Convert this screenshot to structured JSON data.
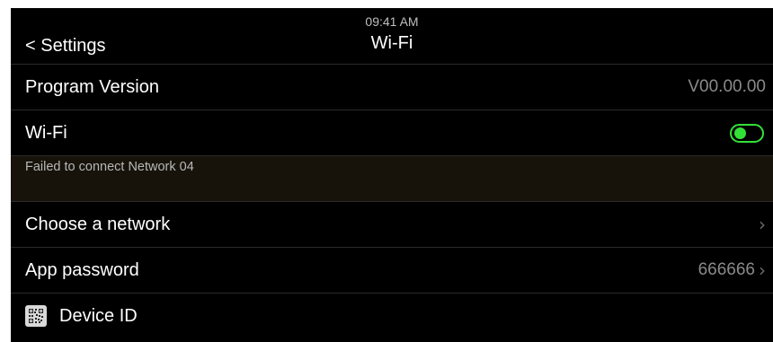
{
  "status_bar": {
    "time": "09:41 AM"
  },
  "nav": {
    "back_label": "< Settings",
    "title": "Wi-Fi"
  },
  "rows": {
    "program_version": {
      "label": "Program Version",
      "value": "V00.00.00"
    },
    "wifi": {
      "label": "Wi-Fi",
      "toggle_on": true
    },
    "status_message": "Failed to connect Network 04",
    "choose_network": {
      "label": "Choose a network"
    },
    "app_password": {
      "label": "App password",
      "value": "666666"
    },
    "device_id": {
      "label": "Device ID",
      "icon": "qr-code-icon"
    }
  },
  "colors": {
    "background": "#000000",
    "toggle_accent": "#33e038",
    "status_band": "#17130b"
  }
}
